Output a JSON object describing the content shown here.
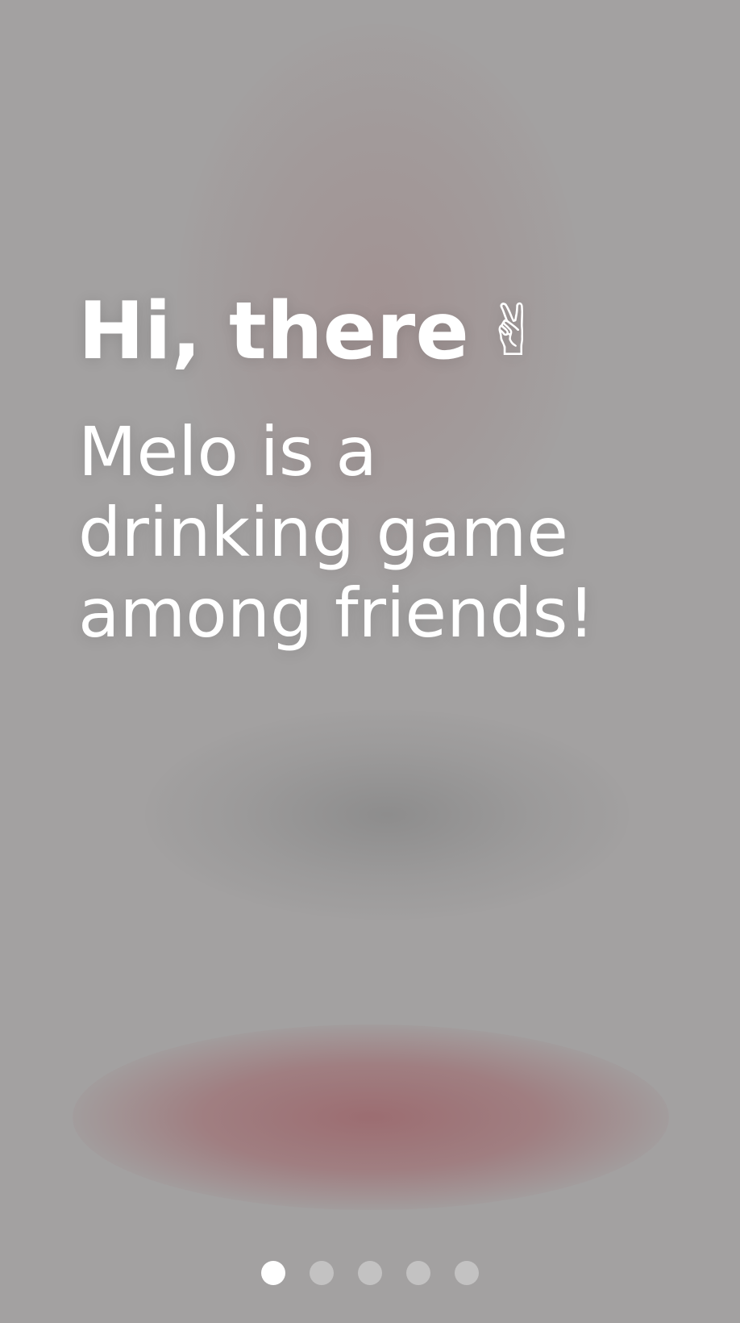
{
  "onboarding": {
    "greeting": "Hi, there",
    "greeting_icon": "✌",
    "greeting_icon_name": "victory-hand-icon",
    "description": "Melo is a drinking game among friends!"
  },
  "pager": {
    "total_pages": 5,
    "current_page": 1
  },
  "colors": {
    "background": "#a3a1a1",
    "text": "#ffffff",
    "blurred_button": "#9e6c70",
    "dot_active": "#ffffff",
    "dot_inactive": "rgba(255,255,255,0.35)"
  }
}
